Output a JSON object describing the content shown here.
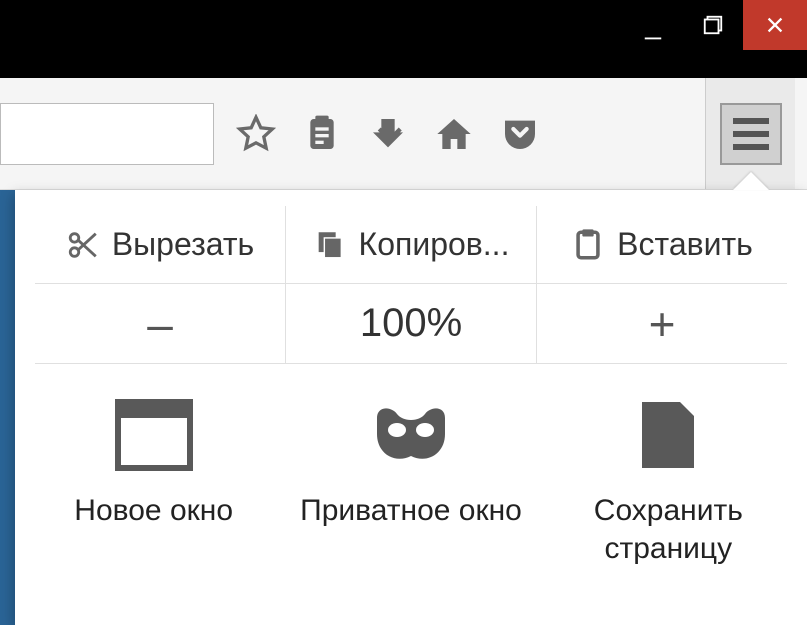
{
  "window_controls": {
    "minimize": "minimize",
    "maximize": "maximize",
    "close": "close"
  },
  "toolbar": {
    "url_value": "",
    "icons": {
      "star": "bookmark-star",
      "clipboard": "reading-list",
      "download": "downloads",
      "home": "home",
      "pocket": "pocket",
      "menu": "menu"
    }
  },
  "menu": {
    "edit": {
      "cut": "Вырезать",
      "copy": "Копиров...",
      "paste": "Вставить"
    },
    "zoom": {
      "minus": "–",
      "level": "100%",
      "plus": "+"
    },
    "items": {
      "new_window": "Новое окно",
      "private_window": "Приватное окно",
      "save_page": "Сохранить страницу"
    }
  }
}
